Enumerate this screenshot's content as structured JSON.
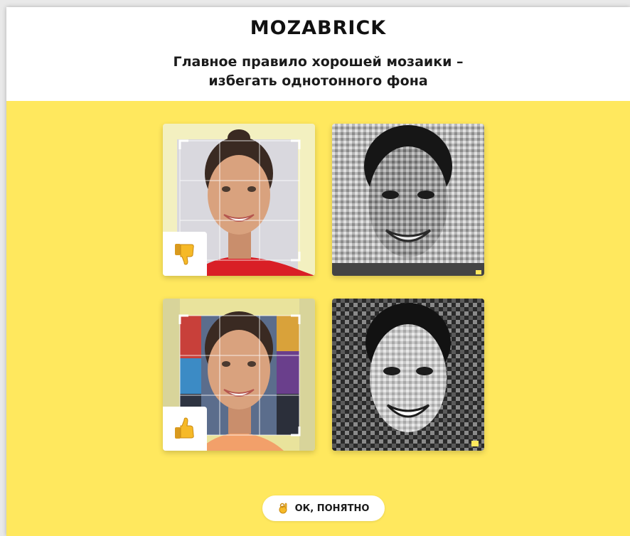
{
  "header": {
    "logo": "MOZABRICK",
    "headline_line1": "Главное правило хорошей мозаики –",
    "headline_line2": "избегать однотонного фона"
  },
  "examples": [
    {
      "original_label": "plain background photo",
      "verdict_icon": "thumbs-down-icon"
    },
    {
      "original_label": "busy background photo",
      "verdict_icon": "thumbs-up-icon"
    }
  ],
  "button": {
    "icon": "ok-hand-icon",
    "label": "ОК, ПОНЯТНО"
  },
  "colors": {
    "background": "#ffe85e",
    "header": "#ffffff",
    "shirt": "#d91f26"
  }
}
